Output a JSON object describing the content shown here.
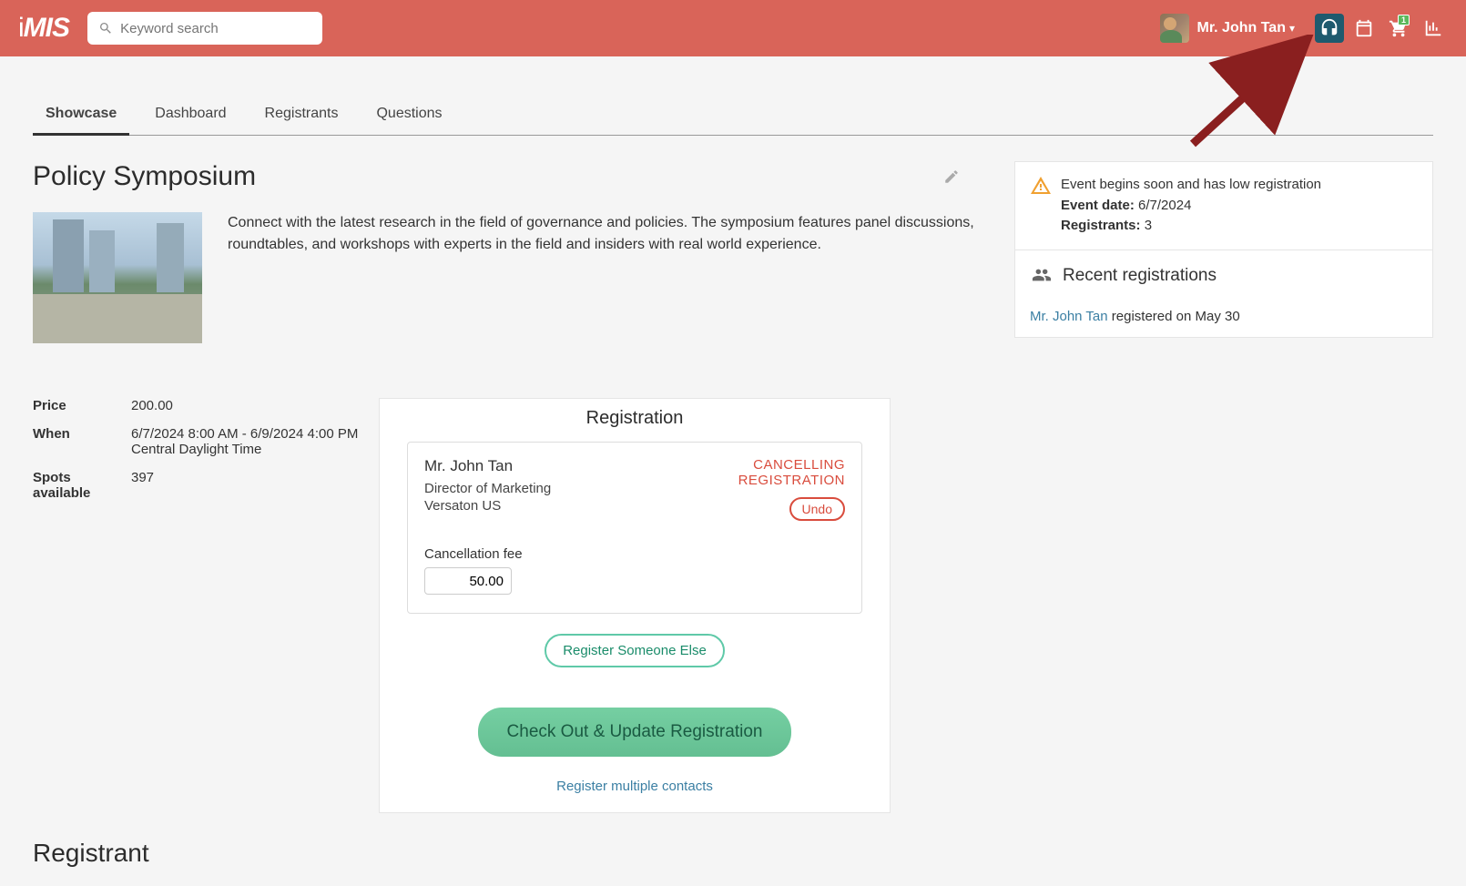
{
  "header": {
    "logo": "iMIS",
    "search_placeholder": "Keyword search",
    "user_name": "Mr. John Tan",
    "cart_count": "1"
  },
  "tabs": [
    "Showcase",
    "Dashboard",
    "Registrants",
    "Questions"
  ],
  "active_tab": 0,
  "event": {
    "title": "Policy Symposium",
    "description": "Connect with the latest research in the field of governance and policies. The symposium features panel discussions, roundtables, and workshops with experts in the field and insiders with real world experience.",
    "price_label": "Price",
    "price": "200.00",
    "when_label": "When",
    "when_line1": "6/7/2024 8:00 AM - 6/9/2024 4:00 PM",
    "when_line2": "Central Daylight Time",
    "spots_label": "Spots available",
    "spots": "397"
  },
  "registration": {
    "panel_title": "Registration",
    "person_name": "Mr. John Tan",
    "person_title": "Director of Marketing",
    "person_company": "Versaton US",
    "status_line1": "CANCELLING",
    "status_line2": "REGISTRATION",
    "undo_label": "Undo",
    "cancel_fee_label": "Cancellation fee",
    "cancel_fee_value": "50.00",
    "register_else_label": "Register Someone Else",
    "checkout_label": "Check Out & Update Registration",
    "register_multiple_label": "Register multiple contacts"
  },
  "sidebar": {
    "warning_text": "Event begins soon and has low registration",
    "event_date_label": "Event date:",
    "event_date": "6/7/2024",
    "registrants_label": "Registrants:",
    "registrants_count": "3",
    "recent_title": "Recent registrations",
    "recent_name": "Mr. John Tan",
    "recent_rest": " registered on May 30"
  },
  "section_heading": "Registrant"
}
